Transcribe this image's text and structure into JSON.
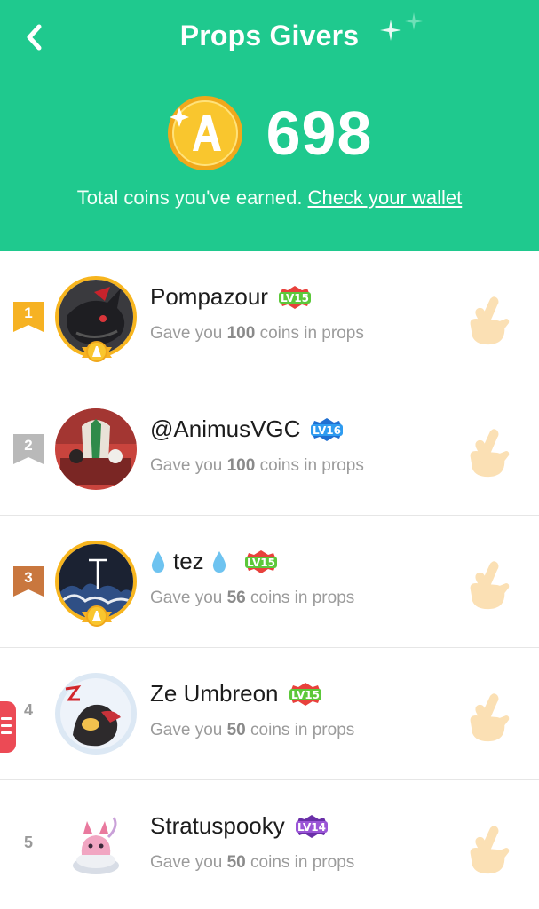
{
  "header": {
    "title": "Props Givers",
    "coin_amount": "698",
    "earned_text": "Total coins you've earned.",
    "wallet_link": "Check your wallet",
    "bg_color": "#1fc98e"
  },
  "givers": [
    {
      "rank": "1",
      "name": "Pompazour",
      "level": "LV15",
      "gave_prefix": "Gave you",
      "coins": "100",
      "gave_suffix": "coins in props"
    },
    {
      "rank": "2",
      "name": "@AnimusVGC",
      "level": "LV16",
      "gave_prefix": "Gave you",
      "coins": "100",
      "gave_suffix": "coins in props"
    },
    {
      "rank": "3",
      "name": "tez",
      "level": "LV15",
      "gave_prefix": "Gave you",
      "coins": "56",
      "gave_suffix": "coins in props"
    },
    {
      "rank": "4",
      "name": "Ze Umbreon",
      "level": "LV15",
      "gave_prefix": "Gave you",
      "coins": "50",
      "gave_suffix": "coins in props"
    },
    {
      "rank": "5",
      "name": "Stratuspooky",
      "level": "LV14",
      "gave_prefix": "Gave you",
      "coins": "50",
      "gave_suffix": "coins in props"
    }
  ],
  "icons": {
    "back": "back-arrow-icon",
    "coin": "amino-coin-icon",
    "props": "fingers-crossed-icon",
    "side_menu": "menu-icon"
  }
}
